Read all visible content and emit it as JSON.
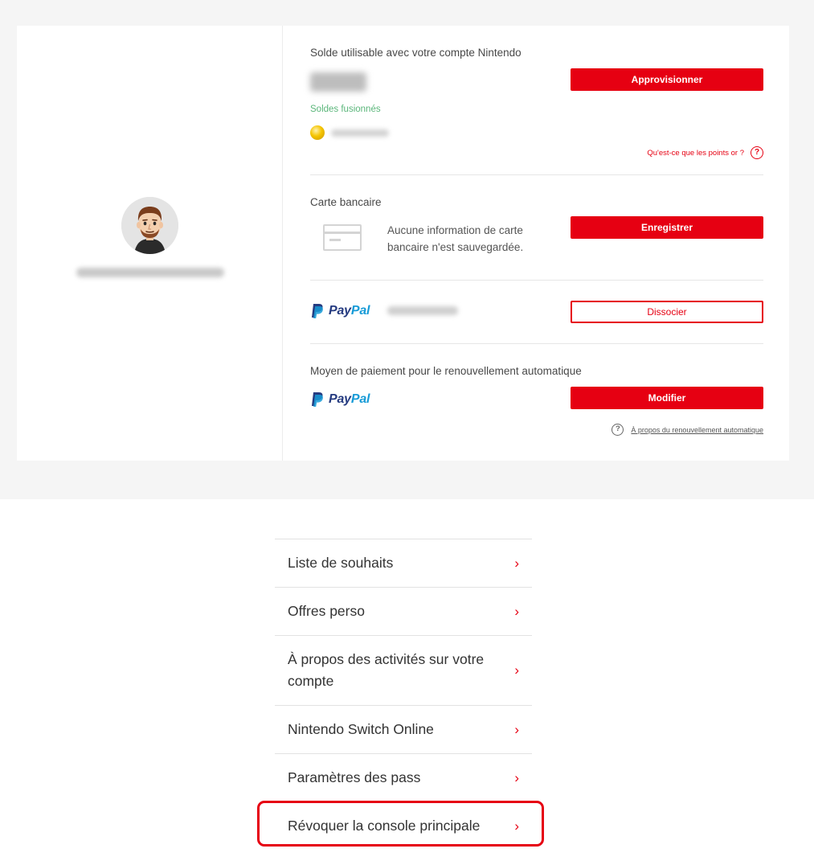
{
  "balance": {
    "heading": "Solde utilisable avec votre compte Nintendo",
    "amount": "0,00 €",
    "topup_label": "Approvisionner",
    "merged_label": "Soldes fusionnés",
    "points_help_label": "Qu'est-ce que les points or ?"
  },
  "credit_card": {
    "heading": "Carte bancaire",
    "empty_message": "Aucune information de carte bancaire n'est sauvegardée.",
    "register_label": "Enregistrer"
  },
  "paypal": {
    "brand_pay": "Pay",
    "brand_pal": "Pal",
    "dissociate_label": "Dissocier"
  },
  "auto_renewal": {
    "heading": "Moyen de paiement pour le renouvellement automatique",
    "modify_label": "Modifier",
    "about_label": "À propos du renouvellement automatique"
  },
  "menu": {
    "items": [
      {
        "label": "Liste de souhaits"
      },
      {
        "label": "Offres perso"
      },
      {
        "label": "À propos des activités sur votre compte"
      },
      {
        "label": "Nintendo Switch Online"
      },
      {
        "label": "Paramètres des pass"
      },
      {
        "label": "Révoquer la console principale"
      }
    ]
  },
  "icons": {
    "chevron": "chevron-right-icon",
    "help": "question-circle-icon",
    "card": "credit-card-icon",
    "coin": "gold-coin-icon"
  },
  "colors": {
    "accent": "#e60012",
    "merged_text": "#5ab67a",
    "paypal_dark": "#253b80",
    "paypal_light": "#179bd7",
    "background": "#f5f5f5"
  }
}
